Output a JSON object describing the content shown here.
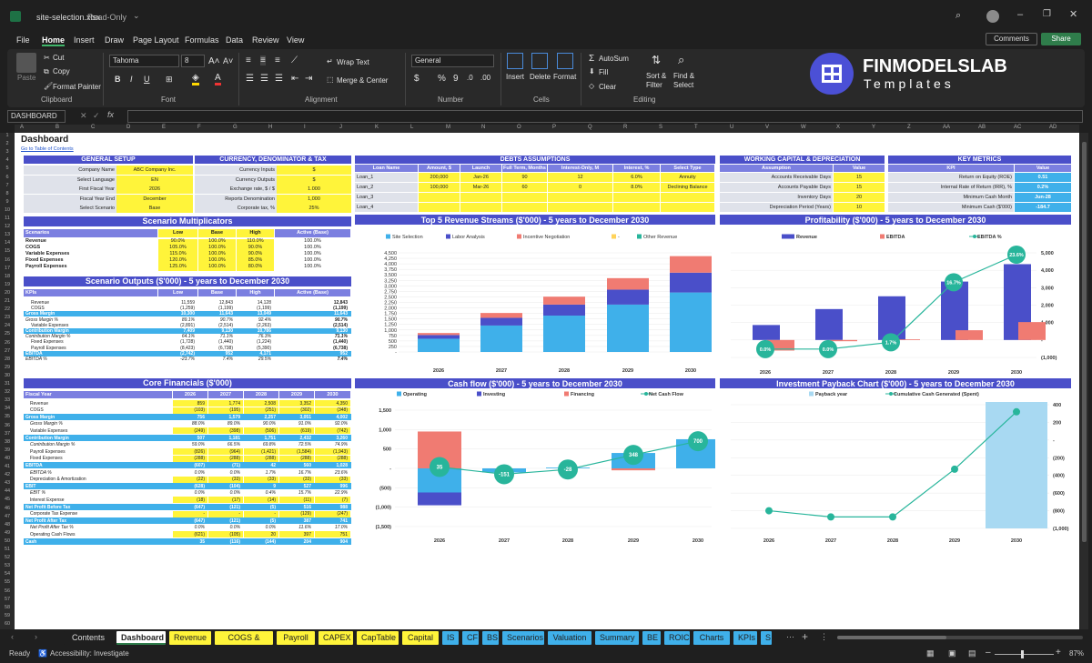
{
  "window": {
    "title": "site-selection.xlsx",
    "mode": "Read-Only"
  },
  "menu": [
    "File",
    "Home",
    "Insert",
    "Draw",
    "Page Layout",
    "Formulas",
    "Data",
    "Review",
    "View"
  ],
  "top_buttons": {
    "comments": "Comments",
    "share": "Share"
  },
  "ribbon": {
    "paste": "Paste",
    "cut": "Cut",
    "copy": "Copy",
    "format_painter": "Format Painter",
    "clipboard": "Clipboard",
    "font_name": "Tahoma",
    "font_size": "8",
    "font": "Font",
    "wrap_text": "Wrap Text",
    "merge_center": "Merge & Center",
    "alignment": "Alignment",
    "number_format": "General",
    "number": "Number",
    "insert": "Insert",
    "delete": "Delete",
    "format": "Format",
    "cells": "Cells",
    "autosum": "AutoSum",
    "fill": "Fill",
    "clear": "Clear",
    "sort_filter": "Sort & Filter",
    "find_select": "Find & Select",
    "editing": "Editing"
  },
  "brand": {
    "name": "FINMODELSLAB",
    "sub": "Templates"
  },
  "formula_bar": {
    "name_box": "DASHBOARD"
  },
  "columns": [
    "A",
    "B",
    "C",
    "D",
    "E",
    "F",
    "G",
    "H",
    "I",
    "J",
    "K",
    "L",
    "M",
    "N",
    "O",
    "P",
    "Q",
    "R",
    "S",
    "T",
    "U",
    "V",
    "W",
    "X",
    "Y",
    "Z",
    "AA",
    "AB",
    "AC",
    "AD"
  ],
  "sheet": {
    "title": "Dashboard",
    "toc": "Go to Table of Contents",
    "general_setup": {
      "title": "GENERAL SETUP",
      "rows": [
        [
          "Company Name",
          "ABC Company Inc."
        ],
        [
          "Select Language",
          "EN"
        ],
        [
          "First Fiscal Year",
          "2026"
        ],
        [
          "Fiscal Year End",
          "December"
        ],
        [
          "Select Scenario",
          "Base"
        ]
      ]
    },
    "currency": {
      "title": "CURRENCY, DENOMINATOR & TAX",
      "rows": [
        [
          "Currency Inputs",
          "$"
        ],
        [
          "Currency Outputs",
          "$"
        ],
        [
          "Exchange rate, $ / $",
          "1.000"
        ],
        [
          "Reports Denomination",
          "1,000"
        ],
        [
          "Corporate tax, %",
          "25%"
        ]
      ]
    },
    "debts": {
      "title": "DEBTS ASSUMPTIONS",
      "headers": [
        "Loan Name",
        "Amount, $",
        "Launch",
        "Full Term, Months",
        "Interest-Only, M",
        "Interest, %",
        "Select Type"
      ],
      "rows": [
        [
          "Loan_1",
          "200,000",
          "Jan-26",
          "90",
          "12",
          "6.0%",
          "Annuity"
        ],
        [
          "Loan_2",
          "100,000",
          "Mar-26",
          "60",
          "0",
          "8.0%",
          "Declining Balance"
        ],
        [
          "Loan_3",
          "",
          "",
          "",
          "",
          "",
          ""
        ],
        [
          "Loan_4",
          "",
          "",
          "",
          "",
          "",
          ""
        ]
      ]
    },
    "wc": {
      "title": "WORKING CAPITAL & DEPRECIATION",
      "headers": [
        "Assumption",
        "Value"
      ],
      "rows": [
        [
          "Accounts Receivable Days",
          "15"
        ],
        [
          "Accounts Payable Days",
          "15"
        ],
        [
          "Inventory Days",
          "20"
        ],
        [
          "Depreciation Period (Years)",
          "10"
        ]
      ]
    },
    "kpi": {
      "title": "KEY METRICS",
      "headers": [
        "KPI",
        "Value"
      ],
      "rows": [
        [
          "Return on Equity (ROE)",
          "0.51"
        ],
        [
          "Internal Rate of Return (IRR), %",
          "0.2%"
        ],
        [
          "Minimum Cash Month",
          "Jun-28"
        ],
        [
          "Minimum Cash ($'000)",
          "-184.7"
        ]
      ]
    },
    "scenario_mult": {
      "title": "Scenario Multiplicators",
      "headers": [
        "Scenarios",
        "Low",
        "Base",
        "High",
        "Active (Base)"
      ],
      "rows": [
        [
          "Revenue",
          "90.0%",
          "100.0%",
          "110.0%",
          "100.0%"
        ],
        [
          "COGS",
          "105.0%",
          "100.0%",
          "90.0%",
          "100.0%"
        ],
        [
          "Variable Expenses",
          "115.0%",
          "100.0%",
          "90.0%",
          "100.0%"
        ],
        [
          "Fixed Expenses",
          "120.0%",
          "100.0%",
          "85.0%",
          "100.0%"
        ],
        [
          "Payroll Expenses",
          "125.0%",
          "100.0%",
          "80.0%",
          "100.0%"
        ]
      ]
    },
    "scenario_out": {
      "title": "Scenario Outputs ($'000) - 5 years to December 2030",
      "headers": [
        "KPIs",
        "Low",
        "Base",
        "High",
        "Active (Base)"
      ],
      "rows": [
        [
          "Revenue",
          "11,559",
          "12,843",
          "14,128",
          "12,843"
        ],
        [
          "COGS",
          "(1,259)",
          "(1,199)",
          "(1,199)",
          "(1,199)"
        ],
        [
          "Gross Margin",
          "10,300",
          "11,643",
          "13,049",
          "11,643"
        ],
        [
          "Gross Margin %",
          "89.1%",
          "90.7%",
          "92.4%",
          "90.7%"
        ],
        [
          "Variable Expenses",
          "(2,891)",
          "(2,514)",
          "(2,263)",
          "(2,514)"
        ],
        [
          "Contribution Margin",
          "7,409",
          "9,130",
          "10,786",
          "9,130"
        ],
        [
          "Contribution Margin %",
          "64.1%",
          "71.1%",
          "76.3%",
          "71.1%"
        ],
        [
          "Fixed Expenses",
          "(1,728)",
          "(1,440)",
          "(1,224)",
          "(1,440)"
        ],
        [
          "Payroll Expenses",
          "(8,423)",
          "(6,738)",
          "(5,390)",
          "(6,738)"
        ],
        [
          "EBITDA",
          "(2,742)",
          "952",
          "4,171",
          "952"
        ],
        [
          "EBITDA %",
          "-23.7%",
          "7.4%",
          "29.5%",
          "7.4%"
        ]
      ]
    },
    "core": {
      "title": "Core Financials ($'000)",
      "headers": [
        "Fiscal Year",
        "2026",
        "2027",
        "2028",
        "2029",
        "2030"
      ],
      "rows": [
        [
          "Revenue",
          "859",
          "1,774",
          "2,508",
          "3,352",
          "4,350"
        ],
        [
          "COGS",
          "(103)",
          "(195)",
          "(251)",
          "(302)",
          "(348)"
        ],
        [
          "Gross Margin",
          "756",
          "1,579",
          "2,257",
          "3,051",
          "4,002"
        ],
        [
          "Gross Margin %",
          "88.0%",
          "89.0%",
          "90.0%",
          "91.0%",
          "92.0%"
        ],
        [
          "Variable Expenses",
          "(249)",
          "(398)",
          "(506)",
          "(619)",
          "(742)"
        ],
        [
          "Contribution Margin",
          "507",
          "1,181",
          "1,751",
          "2,432",
          "3,260"
        ],
        [
          "Contribution Margin %",
          "59.0%",
          "66.5%",
          "69.8%",
          "72.5%",
          "74.9%"
        ],
        [
          "Payroll Expenses",
          "(826)",
          "(964)",
          "(1,421)",
          "(1,584)",
          "(1,943)"
        ],
        [
          "Fixed Expenses",
          "(288)",
          "(288)",
          "(288)",
          "(288)",
          "(288)"
        ],
        [
          "EBITDA",
          "(607)",
          "(71)",
          "42",
          "560",
          "1,028"
        ],
        [
          "EBITDA %",
          "0.0%",
          "0.0%",
          "1.7%",
          "16.7%",
          "23.6%"
        ],
        [
          "Depreciation & Amortization",
          "(22)",
          "(33)",
          "(33)",
          "(33)",
          "(33)"
        ],
        [
          "EBIT",
          "(628)",
          "(104)",
          "9",
          "527",
          "996"
        ],
        [
          "EBIT %",
          "0.0%",
          "0.0%",
          "0.4%",
          "15.7%",
          "22.9%"
        ],
        [
          "Interest Expense",
          "(18)",
          "(17)",
          "(14)",
          "(11)",
          "(7)"
        ],
        [
          "Net Profit Before Tax",
          "(647)",
          "(121)",
          "(5)",
          "516",
          "988"
        ],
        [
          "Corporate Tax Expense",
          "-",
          "-",
          "-",
          "(129)",
          "(247)"
        ],
        [
          "Net Profit After Tax",
          "(647)",
          "(121)",
          "(5)",
          "387",
          "741"
        ],
        [
          "Net Profit After Tax %",
          "0.0%",
          "0.0%",
          "0.0%",
          "11.6%",
          "17.0%"
        ],
        [
          "Operating Cash Flows",
          "(621)",
          "(105)",
          "20",
          "397",
          "751"
        ],
        [
          "Cash",
          "35",
          "(116)",
          "(144)",
          "204",
          "904"
        ]
      ]
    }
  },
  "chart_data": [
    {
      "type": "bar",
      "title": "Top 5 Revenue Streams ($'000) - 5 years to December 2030",
      "categories": [
        "2026",
        "2027",
        "2028",
        "2029",
        "2030"
      ],
      "series": [
        {
          "name": "Site Selection",
          "values": [
            600,
            1200,
            1650,
            2150,
            2700
          ],
          "color": "#3fb0ea"
        },
        {
          "name": "Labor Analysis",
          "values": [
            170,
            350,
            500,
            680,
            900
          ],
          "color": "#4a4fc9"
        },
        {
          "name": "Incentive Negotiation",
          "values": [
            90,
            220,
            360,
            520,
            750
          ],
          "color": "#f07b72"
        },
        {
          "name": "-",
          "values": [
            0,
            0,
            0,
            0,
            0
          ],
          "color": "#ffd35a"
        },
        {
          "name": "Other Revenue",
          "values": [
            0,
            0,
            0,
            0,
            0
          ],
          "color": "#28b59b"
        }
      ],
      "yticks": [
        "-",
        "250",
        "500",
        "750",
        "1,000",
        "1,250",
        "1,500",
        "1,750",
        "2,000",
        "2,250",
        "2,500",
        "2,750",
        "3,000",
        "3,250",
        "3,500",
        "3,750",
        "4,000",
        "4,250",
        "4,500"
      ],
      "ylim": [
        0,
        4500
      ]
    },
    {
      "type": "bar",
      "title": "Profitability ($'000) - 5 years to December 2030",
      "categories": [
        "2026",
        "2027",
        "2028",
        "2029",
        "2030"
      ],
      "series": [
        {
          "name": "Revenue",
          "values": [
            859,
            1774,
            2508,
            3352,
            4350
          ],
          "color": "#4a4fc9"
        },
        {
          "name": "EBITDA",
          "values": [
            -607,
            -71,
            42,
            560,
            1028
          ],
          "color": "#f07b72"
        },
        {
          "name": "EBITDA %",
          "values": [
            0,
            0,
            1.7,
            16.7,
            23.6
          ],
          "labels": [
            "0.0%",
            "0.0%",
            "1.7%",
            "16.7%",
            "23.6%"
          ],
          "color": "#28b59b"
        }
      ],
      "yticks": [
        "(1,000)",
        "-",
        "1,000",
        "2,000",
        "3,000",
        "4,000",
        "5,000"
      ],
      "ylim": [
        -1000,
        5000
      ]
    },
    {
      "type": "bar",
      "title": "Cash flow ($'000) - 5 years to December 2030",
      "categories": [
        "2026",
        "2027",
        "2028",
        "2029",
        "2030"
      ],
      "series": [
        {
          "name": "Operating",
          "values": [
            -621,
            -105,
            20,
            397,
            751
          ],
          "color": "#3fb0ea"
        },
        {
          "name": "Investing",
          "values": [
            -330,
            0,
            0,
            0,
            0
          ],
          "color": "#4a4fc9"
        },
        {
          "name": "Financing",
          "values": [
            950,
            0,
            0,
            -50,
            0
          ],
          "color": "#f07b72"
        },
        {
          "name": "Net Cash Flow",
          "values": [
            35,
            -151,
            -28,
            348,
            700
          ],
          "color": "#28b59b"
        }
      ],
      "yticks": [
        "(1,500)",
        "(1,000)",
        "(500)",
        "-",
        "500",
        "1,000",
        "1,500"
      ],
      "ylim": [
        -1500,
        1500
      ]
    },
    {
      "type": "line",
      "title": "Investment Payback Chart ($'000) - 5 years to December 2030",
      "categories": [
        "2026",
        "2027",
        "2028",
        "2029",
        "2030"
      ],
      "series": [
        {
          "name": "Payback year",
          "values": [
            0,
            0,
            0,
            0,
            1
          ],
          "color": "#a8d9f2"
        },
        {
          "name": "Cumulative Cash Generated (Spent)",
          "values": [
            -800,
            -870,
            -870,
            -330,
            320
          ],
          "color": "#28b59b"
        }
      ],
      "yticks": [
        "(1,000)",
        "(800)",
        "(600)",
        "(400)",
        "(200)",
        "-",
        "200",
        "400"
      ],
      "ylim": [
        -1000,
        400
      ]
    }
  ],
  "tabs": [
    {
      "label": "Contents",
      "color": "#1f1f1f",
      "text": "#ddd"
    },
    {
      "label": "Dashboard",
      "color": "#ffffff",
      "text": "#222"
    },
    {
      "label": "Revenue",
      "color": "#fff43a"
    },
    {
      "label": "COGS & OPEX",
      "color": "#fff43a"
    },
    {
      "label": "Payroll",
      "color": "#fff43a"
    },
    {
      "label": "CAPEX",
      "color": "#fff43a"
    },
    {
      "label": "CapTable",
      "color": "#fff43a"
    },
    {
      "label": "Capital",
      "color": "#fff43a"
    },
    {
      "label": "IS",
      "color": "#3fb0ea"
    },
    {
      "label": "CF",
      "color": "#3fb0ea"
    },
    {
      "label": "BS",
      "color": "#3fb0ea"
    },
    {
      "label": "Scenarios",
      "color": "#3fb0ea"
    },
    {
      "label": "Valuation",
      "color": "#3fb0ea"
    },
    {
      "label": "Summary",
      "color": "#3fb0ea"
    },
    {
      "label": "BE",
      "color": "#3fb0ea"
    },
    {
      "label": "ROIC",
      "color": "#3fb0ea"
    },
    {
      "label": "Charts",
      "color": "#3fb0ea"
    },
    {
      "label": "KPIs",
      "color": "#3fb0ea"
    },
    {
      "label": "S",
      "color": "#3fb0ea"
    }
  ],
  "status": {
    "ready": "Ready",
    "accessibility": "Accessibility: Investigate",
    "zoom": "87%"
  }
}
